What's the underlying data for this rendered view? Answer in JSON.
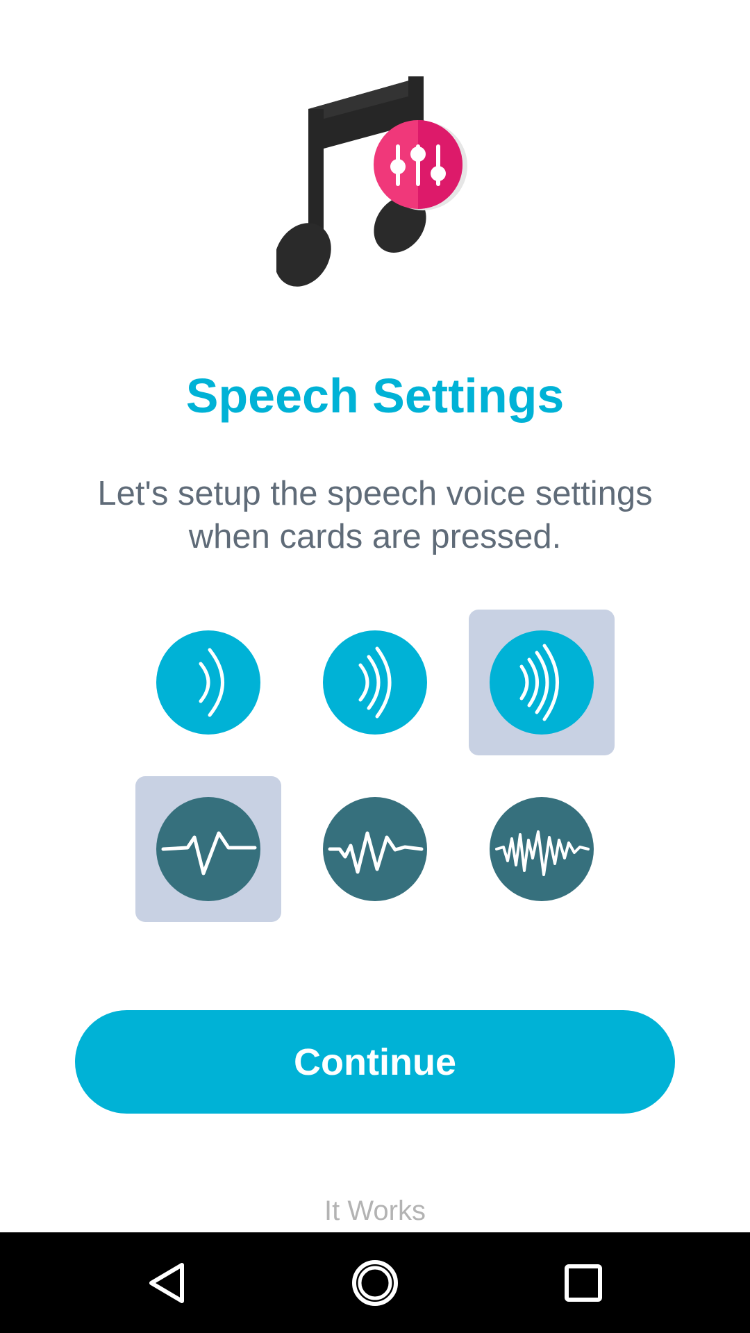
{
  "header": {
    "title": "Speech Settings",
    "subtitle": "Let's setup the speech voice settings when cards are pressed."
  },
  "options": {
    "volume": [
      {
        "icon": "volume-low-icon",
        "selected": false
      },
      {
        "icon": "volume-medium-icon",
        "selected": false
      },
      {
        "icon": "volume-high-icon",
        "selected": true
      }
    ],
    "pitch": [
      {
        "icon": "pitch-low-icon",
        "selected": true
      },
      {
        "icon": "pitch-medium-icon",
        "selected": false
      },
      {
        "icon": "pitch-high-icon",
        "selected": false
      }
    ]
  },
  "actions": {
    "continue_label": "Continue"
  },
  "footer": {
    "text": "It Works"
  },
  "nav": {
    "icons": [
      "back-icon",
      "home-icon",
      "recents-icon"
    ]
  },
  "colors": {
    "accent": "#00b2d6",
    "pitch_circle": "#36707d",
    "selected_tile": "#c8d1e3",
    "logo_badge": "#e91e63"
  }
}
